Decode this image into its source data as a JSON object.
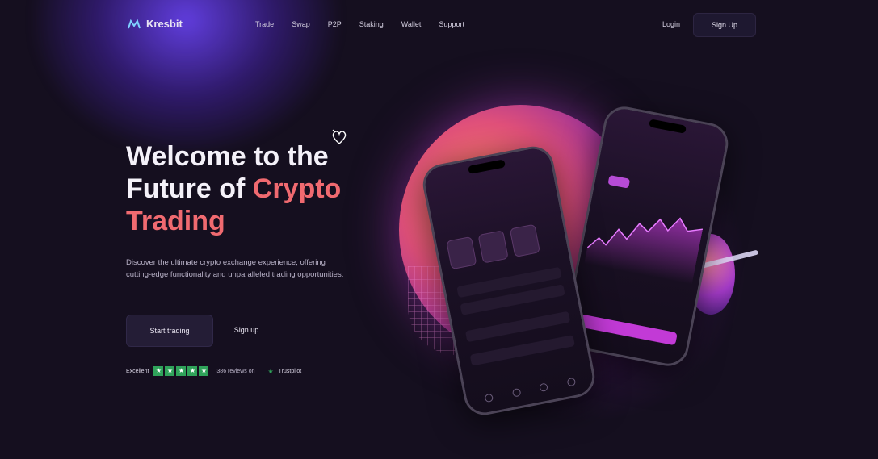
{
  "brand": {
    "name": "Kresbit"
  },
  "nav": {
    "links": [
      "Trade",
      "Swap",
      "P2P",
      "Staking",
      "Wallet",
      "Support"
    ],
    "login_label": "Login",
    "signup_label": "Sign Up"
  },
  "hero": {
    "title_line1": "Welcome to the",
    "title_line2_plain": "Future of ",
    "title_line2_highlight": "Crypto",
    "title_line3_highlight": "Trading",
    "description": "Discover the ultimate crypto exchange experience, offering cutting-edge functionality and unparalleled trading opportunities.",
    "start_label": "Start trading",
    "signup_label": "Sign up"
  },
  "trust": {
    "label": "Excellent",
    "stars": 5,
    "reviews": "386 reviews on",
    "platform": "Trustpilot"
  },
  "colors": {
    "background": "#150f1f",
    "highlight": "#f06a70",
    "accent": "#c23ad6",
    "trustpilot_green": "#2fa35a"
  },
  "icons": {
    "logo": "kresbit-logo-icon",
    "heart": "heart-doodle-icon",
    "star": "star-icon",
    "trustpilot": "trustpilot-star-icon"
  }
}
